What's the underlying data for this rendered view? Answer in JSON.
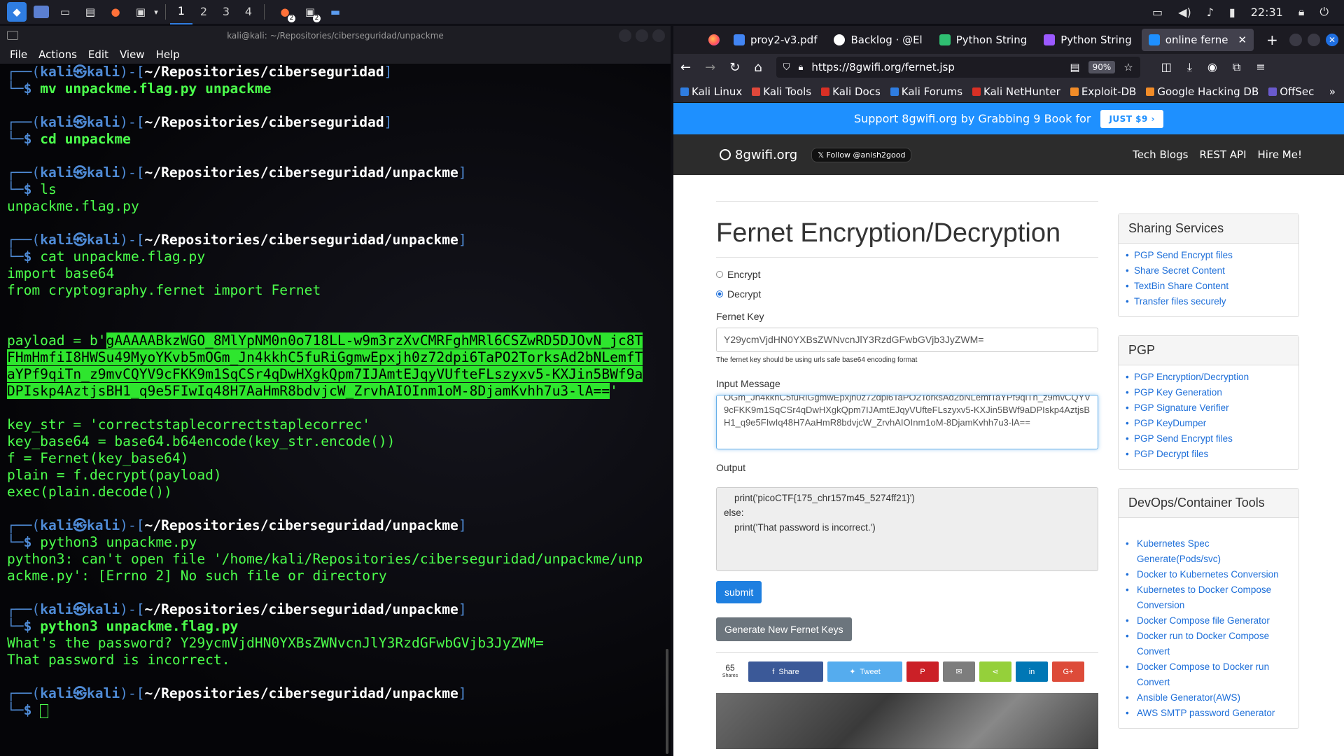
{
  "panel": {
    "workspaces": [
      "1",
      "2",
      "3",
      "4"
    ],
    "badges": [
      "2",
      "2"
    ],
    "clock": "22:31"
  },
  "terminal": {
    "title": "kali@kali: ~/Repositories/ciberseguridad/unpackme",
    "menu": [
      "File",
      "Actions",
      "Edit",
      "View",
      "Help"
    ],
    "prompts": {
      "user": "kali",
      "sep": "㉿",
      "host": "kali",
      "path1": "~/Repositories/ciberseguridad",
      "path2": "~/Repositories/ciberseguridad/unpackme"
    },
    "commands": {
      "c1": "mv unpackme.flag.py unpackme",
      "c2": "cd unpackme",
      "c3": "ls",
      "c4": "cat unpackme.flag.py",
      "c5": "python3 unpackme.py",
      "c6": "python3 unpackme.flag.py"
    },
    "ls_out": "unpackme.flag.py",
    "code": {
      "l1": "import base64",
      "l2": "from cryptography.fernet import Fernet",
      "payload_prefix": "payload = b'",
      "payload_1": "gAAAAABkzWGO_8MlYpNM0n0o718LL-w9m3rzXvCMRFghMRl6CSZwRD5DJOvN_jc8T",
      "payload_2": "FHmHmfiI8HWSu49MyoYKvb5mOGm_Jn4kkhC5fuRiGgmwEpxjh0z72dpi6TaPO2TorksAd2bNLemfT",
      "payload_3": "aYPf9qiTn_z9mvCQYV9cFKK9m1SqCSr4qDwHXgkQpm7IJAmtEJqyVUfteFLszyxv5-KXJin5BWf9a",
      "payload_4": "DPIskp4AztjsBH1_q9e5FIwIq48H7AaHmR8bdvjcW_ZrvhAIOInm1oM-8DjamKvhh7u3-lA==",
      "payload_suffix": "'",
      "k1": "key_str = 'correctstaplecorrectstaplecorrec'",
      "k2": "key_base64 = base64.b64encode(key_str.encode())",
      "k3": "f = Fernet(key_base64)",
      "k4": "plain = f.decrypt(payload)",
      "k5": "exec(plain.decode())"
    },
    "err_1": "python3: can't open file '/home/kali/Repositories/ciberseguridad/unpackme/unp",
    "err_2": "ackme.py': [Errno 2] No such file or directory",
    "run_1": "What's the password? Y29ycmVjdHN0YXBsZWNvcnJlY3RzdGFwbGVjb3JyZWM=",
    "run_2": "That password is incorrect."
  },
  "browser": {
    "tabs": [
      {
        "label": "proy2-v3.pdf",
        "color": "#4285f4"
      },
      {
        "label": "Backlog · @El",
        "color": "#ffffff"
      },
      {
        "label": "Python String",
        "color": "#2fbf71"
      },
      {
        "label": "Python String",
        "color": "#9b59ff"
      },
      {
        "label": "online ferne",
        "color": "#1e90ff"
      }
    ],
    "url": "https://8gwifi.org/fernet.jsp",
    "zoom": "90%",
    "bookmarks": [
      {
        "label": "Kali Linux",
        "color": "#2f7de1"
      },
      {
        "label": "Kali Tools",
        "color": "#e0483b"
      },
      {
        "label": "Kali Docs",
        "color": "#d93025"
      },
      {
        "label": "Kali Forums",
        "color": "#2f7de1"
      },
      {
        "label": "Kali NetHunter",
        "color": "#d93025"
      },
      {
        "label": "Exploit-DB",
        "color": "#f28c28"
      },
      {
        "label": "Google Hacking DB",
        "color": "#f28c28"
      },
      {
        "label": "OffSec",
        "color": "#6a5acd"
      }
    ]
  },
  "site": {
    "promo_text": "Support 8gwifi.org by Grabbing 9 Book for",
    "promo_btn": "JUST $9 ›",
    "brand": "8gwifi.org",
    "follow": "𝕏 Follow @anish2good",
    "nav_links": [
      "Tech Blogs",
      "REST API",
      "Hire Me!"
    ],
    "title": "Fernet Encryption/Decryption",
    "radio_encrypt": "Encrypt",
    "radio_decrypt": "Decrypt",
    "key_label": "Fernet Key",
    "key_value": "Y29ycmVjdHN0YXBsZWNvcnJlY3RzdGFwbGVjb3JyZWM=",
    "key_hint": "The fernet key should be using urls safe base64 encoding format",
    "input_label": "Input Message",
    "input_value": "OGm_Jn4kkhC5fuRiGgmwEpxjh0z72dpi6TaPO2TorksAd2bNLemfTaYPf9qiTn_z9mvCQYV9cFKK9m1SqCSr4qDwHXgkQpm7IJAmtEJqyVUfteFLszyxv5-KXJin5BWf9aDPIskp4AztjsBH1_q9e5FIwIq48H7AaHmR8bdvjcW_ZrvhAIOInm1oM-8DjamKvhh7u3-lA==",
    "output_label": "Output",
    "output_value": "    print('picoCTF{175_chr157m45_5274ff21}')\nelse:\n    print('That password is incorrect.')",
    "submit": "submit",
    "generate": "Generate New Fernet Keys",
    "share_count": "65",
    "share_word": "Shares",
    "share_fb": "Share",
    "share_tw": "Tweet",
    "sidebar": {
      "sharing_title": "Sharing Services",
      "sharing": [
        "PGP Send Encrypt files",
        "Share Secret Content",
        "TextBin Share Content",
        "Transfer files securely"
      ],
      "pgp_title": "PGP",
      "pgp": [
        "PGP Encryption/Decryption",
        "PGP Key Generation",
        "PGP Signature Verifier",
        "PGP KeyDumper",
        "PGP Send Encrypt files",
        "PGP Decrypt files"
      ],
      "devops_title": "DevOps/Container Tools",
      "devops": [
        "Kubernetes Spec Generate(Pods/svc)",
        "Docker to Kubernetes Conversion",
        "Kubernetes to Docker Compose Conversion",
        "Docker Compose file Generator",
        "Docker run to Docker Compose Convert",
        "Docker Compose to Docker run Convert",
        "Ansible Generator(AWS)",
        "AWS SMTP password Generator"
      ]
    }
  }
}
